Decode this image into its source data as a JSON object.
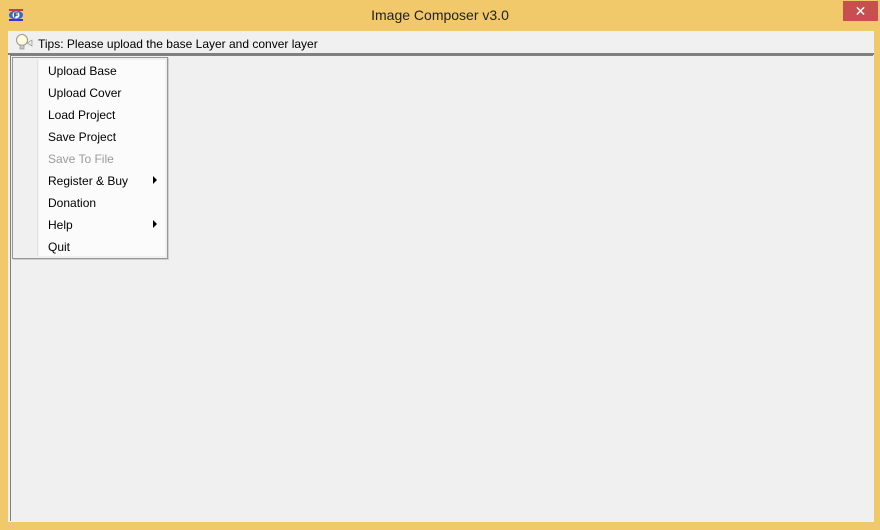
{
  "window": {
    "title": "Image Composer v3.0",
    "close_label": "✕",
    "accent": "#f1c96b",
    "close_color": "#c7504e"
  },
  "tips": {
    "icon": "lightbulb-icon",
    "text": "Tips: Please upload the base Layer and conver layer"
  },
  "menu": {
    "items": [
      {
        "label": "Upload Base",
        "enabled": true,
        "submenu": false
      },
      {
        "label": "Upload Cover",
        "enabled": true,
        "submenu": false
      },
      {
        "label": "Load Project",
        "enabled": true,
        "submenu": false
      },
      {
        "label": "Save Project",
        "enabled": true,
        "submenu": false
      },
      {
        "label": "Save To File",
        "enabled": false,
        "submenu": false
      },
      {
        "label": "Register & Buy",
        "enabled": true,
        "submenu": true
      },
      {
        "label": "Donation",
        "enabled": true,
        "submenu": false
      },
      {
        "label": "Help",
        "enabled": true,
        "submenu": true
      },
      {
        "label": "Quit",
        "enabled": true,
        "submenu": false
      }
    ]
  }
}
